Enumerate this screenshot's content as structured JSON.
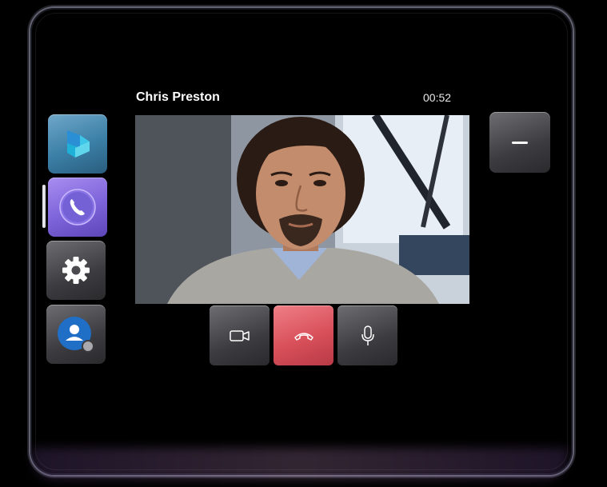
{
  "call": {
    "name": "Chris Preston",
    "duration": "00:52"
  },
  "sidebar": {
    "items": [
      {
        "id": "app",
        "icon": "dynamics-logo-icon",
        "active": false
      },
      {
        "id": "calls",
        "icon": "phone-icon",
        "active": true
      },
      {
        "id": "settings",
        "icon": "gear-icon",
        "active": false
      },
      {
        "id": "profile",
        "icon": "person-icon",
        "active": false,
        "status": "offline"
      }
    ]
  },
  "controls": [
    {
      "id": "camera",
      "icon": "video-camera-icon"
    },
    {
      "id": "hangup",
      "icon": "hang-up-icon"
    },
    {
      "id": "microphone",
      "icon": "microphone-icon"
    }
  ],
  "window": {
    "minimize_icon": "minimize-icon"
  },
  "colors": {
    "hangup": "#d8505a",
    "calls_tile": "#7c63d9",
    "app_tile": "#3b7fa6",
    "profile_avatar": "#1f6fc7"
  }
}
